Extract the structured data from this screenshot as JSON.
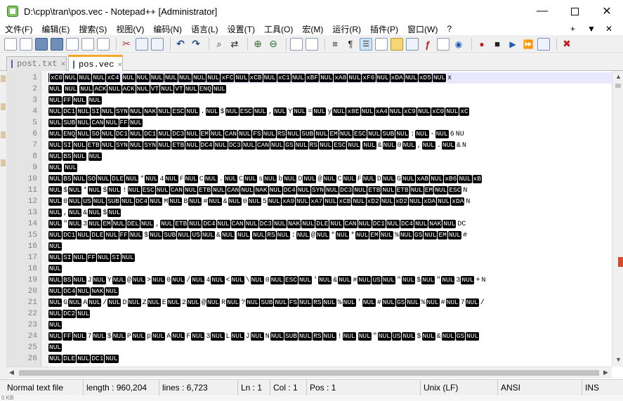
{
  "window": {
    "title": "D:\\cpp\\tran\\pos.vec - Notepad++ [Administrator]",
    "controls": {
      "minimize": "—",
      "maximize": "",
      "close": "✕"
    }
  },
  "menu": {
    "items": [
      "文件(F)",
      "编辑(E)",
      "搜索(S)",
      "视图(V)",
      "编码(N)",
      "语言(L)",
      "设置(T)",
      "工具(O)",
      "宏(M)",
      "运行(R)",
      "插件(P)",
      "窗口(W)",
      "?"
    ],
    "plus": "+",
    "dropdown": "▼",
    "close": "✕"
  },
  "tabs": [
    {
      "label": "post.txt",
      "close": "✕",
      "active": false
    },
    {
      "label": "pos.vec",
      "close": "✕",
      "active": true
    }
  ],
  "editor": {
    "lines": [
      {
        "n": "1",
        "t": [
          "xC0",
          "NUL",
          "NUL",
          "NUL",
          "xC4",
          " ",
          "NUL",
          "NUL",
          "NUL",
          "NUL",
          "NUL",
          "NUL",
          "NUL",
          "xFC",
          "NUL",
          "xCB",
          "NUL",
          "xC1",
          "NUL",
          "xBF",
          "NUL",
          "xA8",
          "NUL",
          "xF6",
          "NUL",
          "xDA",
          "NUL",
          "xD5",
          "NUL",
          "x"
        ]
      },
      {
        "n": "2",
        "t": [
          "NUL",
          " ",
          "NUL",
          " ",
          "NUL",
          "ACK",
          "NUL",
          "ACK",
          "NUL",
          "VT",
          "NUL",
          "VT",
          "NUL",
          "ENQ",
          "NUL"
        ]
      },
      {
        "n": "3",
        "t": [
          "NUL",
          "FF",
          "NUL",
          " ",
          "NUL"
        ]
      },
      {
        "n": "4",
        "t": [
          "NUL",
          "DC1",
          "NUL",
          "SI",
          "NUL",
          "SYN",
          "NUL",
          "NAK",
          "NUL",
          "ESC",
          "NUL",
          ".",
          "NUL",
          "$",
          "NUL",
          "ESC",
          "NUL",
          ",",
          "NUL",
          "Y",
          "NUL",
          "=",
          "NUL",
          "y",
          "NUL",
          "x8E",
          "NUL",
          "xA4",
          "NUL",
          "xC9",
          "NUL",
          "xC0",
          "NUL",
          "xC"
        ]
      },
      {
        "n": "5",
        "t": [
          "NUL",
          "SUB",
          "NUL",
          "CAN",
          "NUL",
          "FF",
          "NUL"
        ]
      },
      {
        "n": "6",
        "t": [
          "NUL",
          "ENQ",
          "NUL",
          "SO",
          "NUL",
          "DC1",
          "NUL",
          "DC1",
          "NUL",
          "DC3",
          "NUL",
          "EM",
          "NUL",
          "CAN",
          "NUL",
          "FS",
          "NUL",
          "RS",
          "NUL",
          "SUB",
          "NUL",
          "EM",
          "NUL",
          "ESC",
          "NUL",
          "SUB",
          "NUL",
          ":",
          "NUL",
          "-",
          "NUL",
          "6",
          "NU"
        ]
      },
      {
        "n": "7",
        "t": [
          "NUL",
          "SI",
          "NUL",
          "ETB",
          "NUL",
          "SYN",
          "NUL",
          "SYN",
          "NUL",
          "ETB",
          "NUL",
          "DC4",
          "NUL",
          "DC3",
          "NUL",
          "CAN",
          "NUL",
          "GS",
          "NUL",
          "RS",
          "NUL",
          "ESC",
          "NUL",
          " ",
          "NUL",
          "&",
          "NUL",
          "0",
          "NUL",
          ",",
          "NUL",
          ".",
          "NUL",
          "&",
          "N"
        ]
      },
      {
        "n": "8",
        "t": [
          "NUL",
          "BS",
          "NUL",
          " ",
          "NUL"
        ]
      },
      {
        "n": "9",
        "t": [
          "NUL",
          " ",
          "NUL"
        ]
      },
      {
        "n": "10",
        "t": [
          "NUL",
          "BS",
          "NUL",
          "SO",
          "NUL",
          "DLE",
          "NUL",
          "*",
          "NUL",
          "4",
          "NUL",
          "F",
          "NUL",
          "C",
          "NUL",
          ".",
          "NUL",
          "C",
          "NUL",
          "s",
          "NUL",
          "b",
          "NUL",
          "D",
          "NUL",
          "@",
          "NUL",
          "C",
          "NUL",
          "F",
          "NUL",
          "D",
          "NUL",
          "G",
          "NUL",
          "xAB",
          "NUL",
          "xB6",
          "NUL",
          "xB"
        ]
      },
      {
        "n": "11",
        "t": [
          "NUL",
          "$",
          "NUL",
          "*",
          "NUL",
          "$",
          "NUL",
          "!",
          "NUL",
          "ESC",
          "NUL",
          "CAN",
          "NUL",
          "ETB",
          "NUL",
          "CAN",
          "NUL",
          "NAK",
          "NUL",
          "DC4",
          "NUL",
          "SYN",
          "NUL",
          "DC3",
          "NUL",
          "ETB",
          "NUL",
          "ETB",
          "NUL",
          "EM",
          "NUL",
          "ESC",
          "N"
        ]
      },
      {
        "n": "12",
        "t": [
          "NUL",
          "0",
          "NUL",
          "US",
          "NUL",
          "SUB",
          "NUL",
          "DC4",
          "NUL",
          "M",
          "NUL",
          "B",
          "NUL",
          "#",
          "NUL",
          "&",
          "NUL",
          "0",
          "NUL",
          "5",
          "NUL",
          "xA9",
          "NUL",
          "xA7",
          "NUL",
          "xCB",
          "NUL",
          "xD2",
          "NUL",
          "xD2",
          "NUL",
          "xDA",
          "NUL",
          "xDA",
          "N"
        ]
      },
      {
        "n": "13",
        "t": [
          "NUL",
          ",",
          "NUL",
          "&",
          "NUL",
          "$",
          "NUL"
        ]
      },
      {
        "n": "14",
        "t": [
          "NUL",
          "\"",
          "NUL",
          "3",
          "NUL",
          "EM",
          "NUL",
          "DEL",
          "NUL",
          ",",
          "NUL",
          "ETB",
          "NUL",
          "DC4",
          "NUL",
          "CAN",
          "NUL",
          "DC3",
          "NUL",
          "NAK",
          "NUL",
          "DLE",
          "NUL",
          "CAN",
          "NUL",
          "DC1",
          "NUL",
          "DC4",
          "NUL",
          "NAK",
          "NUL",
          "DC"
        ]
      },
      {
        "n": "15",
        "t": [
          "NUL",
          "DC1",
          "NUL",
          "DLE",
          "NUL",
          "FF",
          "NUL",
          "$",
          "NUL",
          "SUB",
          "NUL",
          "US",
          "NUL",
          "&",
          "NUL",
          " ",
          "NUL",
          " ",
          "NUL",
          "RS",
          "NUL",
          ":",
          "NUL",
          "@",
          "NUL",
          "*",
          "NUL",
          "*",
          "NUL",
          "EM",
          "NUL",
          "%",
          "NUL",
          "GS",
          "NUL",
          "EM",
          "NUL",
          "#"
        ]
      },
      {
        "n": "16",
        "t": [
          "NUL"
        ]
      },
      {
        "n": "17",
        "t": [
          "NUL",
          "SI",
          "NUL",
          "FF",
          "NUL",
          "SI",
          "NUL"
        ]
      },
      {
        "n": "18",
        "t": [
          "NUL"
        ]
      },
      {
        "n": "19",
        "t": [
          "NUL",
          "BS",
          "NUL",
          "J",
          "NUL",
          "Y",
          "NUL",
          "@",
          "NUL",
          ">",
          "NUL",
          "0",
          "NUL",
          "/",
          "NUL",
          "4",
          "NUL",
          "<",
          "NUL",
          "\\",
          "NUL",
          "0",
          "NUL",
          "ESC",
          "NUL",
          "'",
          "NUL",
          "&",
          "NUL",
          "#",
          "NUL",
          "US",
          "NUL",
          "\"",
          "NUL",
          "$",
          "NUL",
          "\"",
          "NUL",
          "3",
          "NUL",
          "+",
          "N"
        ]
      },
      {
        "n": "20",
        "t": [
          "NUL",
          "DC4",
          "NUL",
          "NAK",
          "NUL"
        ]
      },
      {
        "n": "21",
        "t": [
          "NUL",
          "G",
          "NUL",
          "A",
          "NUL",
          "/",
          "NUL",
          "D",
          "NUL",
          "Z",
          "NUL",
          "E",
          "NUL",
          "2",
          "NUL",
          "@",
          "NUL",
          "R",
          "NUL",
          "?",
          "NUL",
          "SUB",
          "NUL",
          "FS",
          "NUL",
          "RS",
          "NUL",
          "%",
          "NUL",
          "'",
          "NUL",
          "#",
          "NUL",
          "GS",
          "NUL",
          "%",
          "NUL",
          "#",
          "NUL",
          "7",
          "NUL",
          "/"
        ]
      },
      {
        "n": "22",
        "t": [
          "NUL",
          "DC2",
          "NUL"
        ]
      },
      {
        "n": "23",
        "t": [
          "NUL"
        ]
      },
      {
        "n": "24",
        "t": [
          "NUL",
          "FF",
          "NUL",
          "7",
          "NUL",
          "$",
          "NUL",
          "P",
          "NUL",
          "p",
          "NUL",
          "A",
          "NUL",
          "F",
          "NUL",
          "3",
          "NUL",
          "L",
          "NUL",
          "J",
          "NUL",
          "N",
          "NUL",
          "SUB",
          "NUL",
          "RS",
          "NUL",
          "!",
          "NUL",
          " ",
          "NUL",
          "\"",
          "NUL",
          "US",
          "NUL",
          "$",
          "NUL",
          "&",
          "NUL",
          "GS",
          "NUL"
        ]
      },
      {
        "n": "25",
        "t": [
          "NUL"
        ]
      },
      {
        "n": "26",
        "t": [
          "NUL",
          "DLE",
          "NUL",
          "DC1",
          "NUL"
        ]
      }
    ]
  },
  "status": {
    "mode": "Normal text file",
    "length": "length : 960,204",
    "lines": "lines : 6,723",
    "ln": "Ln : 1",
    "col": "Col : 1",
    "pos": "Pos : 1",
    "eol": "Unix (LF)",
    "encoding": "ANSI",
    "ins": "INS"
  },
  "bottom_text": "0 KB",
  "colors": {
    "current_line": "#e8e8ff",
    "token_bg": "#000000",
    "token_fg": "#ffffff",
    "active_tab_accent": "#f5a623"
  }
}
